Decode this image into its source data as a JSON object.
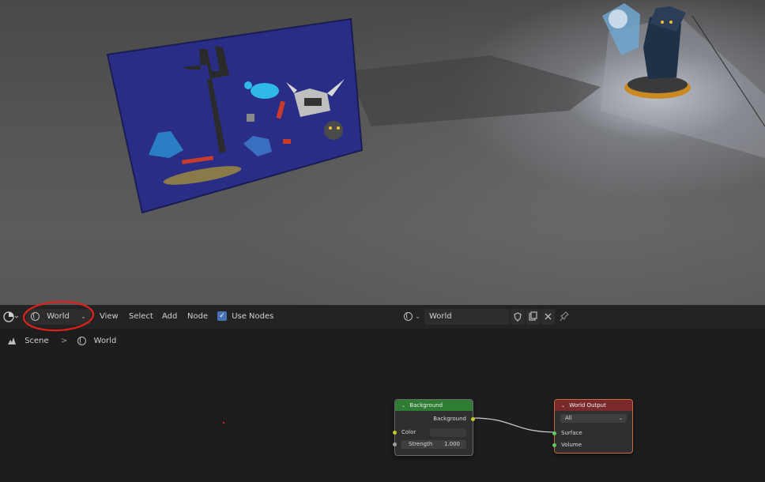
{
  "header": {
    "editor_type_icon": "node-editor-icon",
    "shader_type": {
      "icon": "world-icon",
      "value": "World"
    },
    "menus": [
      "View",
      "Select",
      "Add",
      "Node"
    ],
    "use_nodes": {
      "label": "Use Nodes",
      "checked": true
    },
    "world_block": {
      "icon": "world-icon",
      "name": "World",
      "buttons": [
        "shield-icon",
        "duplicate-icon",
        "close-icon"
      ]
    },
    "pin_icon": "pin-icon"
  },
  "breadcrumb": {
    "scene": "Scene",
    "separator": ">",
    "world": "World"
  },
  "nodes": {
    "background": {
      "title": "Background",
      "output": "Background",
      "color_label": "Color",
      "strength_label": "Strength",
      "strength_value": "1.000",
      "header_color": "#2e7d32"
    },
    "world_output": {
      "title": "World Output",
      "target": "All",
      "inputs": [
        "Surface",
        "Volume"
      ],
      "header_color": "#7a2a2a"
    }
  },
  "annotation": {
    "color": "#e0201a"
  }
}
